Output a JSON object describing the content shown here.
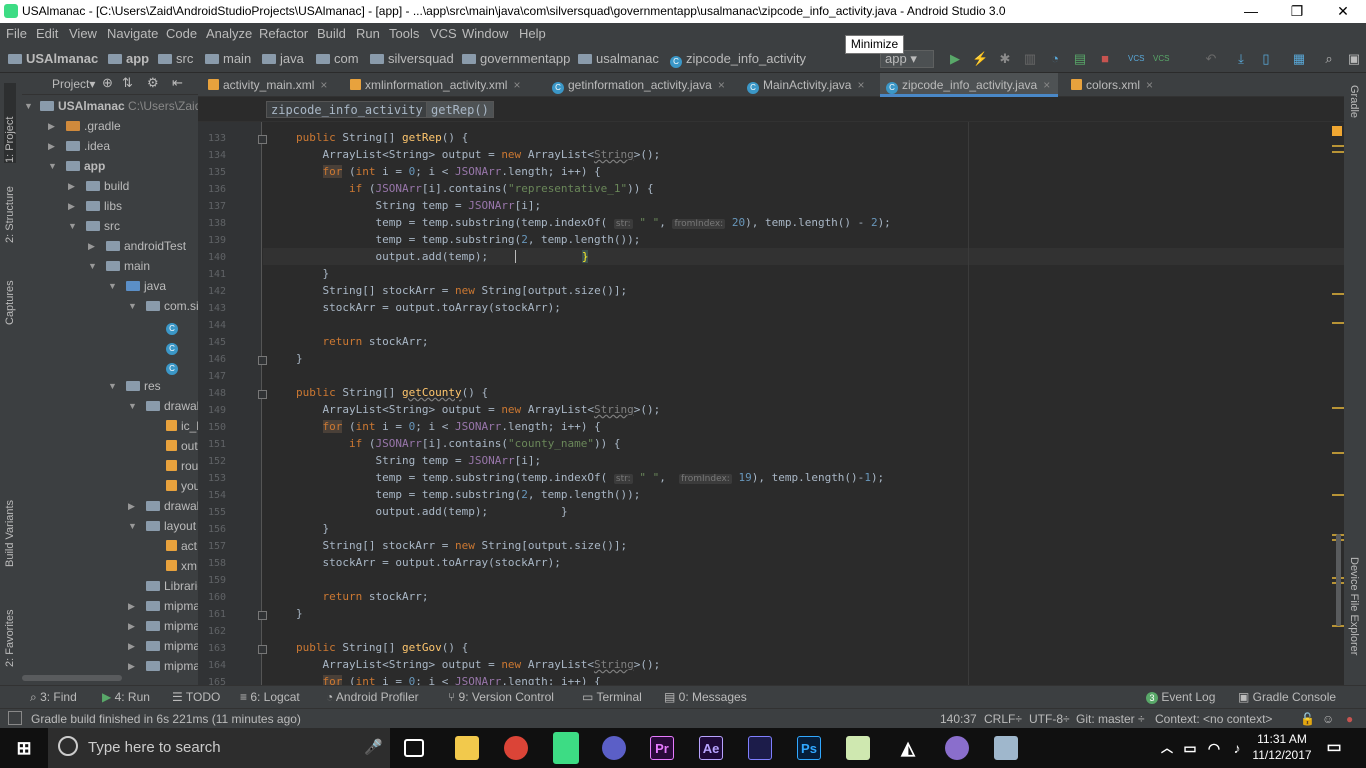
{
  "window": {
    "title": "USAlmanac - [C:\\Users\\Zaid\\AndroidStudioProjects\\USAlmanac] - [app] - ...\\app\\src\\main\\java\\com\\silversquad\\governmentapp\\usalmanac\\zipcode_info_activity.java - Android Studio 3.0",
    "minimize": "—",
    "maximize": "❐",
    "close": "✕",
    "tooltip": "Minimize"
  },
  "menu": [
    "File",
    "Edit",
    "View",
    "Navigate",
    "Code",
    "Analyze",
    "Refactor",
    "Build",
    "Run",
    "Tools",
    "VCS",
    "Window",
    "Help"
  ],
  "breadcrumbs": [
    "USAlmanac",
    "app",
    "src",
    "main",
    "java",
    "com",
    "silversquad",
    "governmentapp",
    "usalmanac",
    "zipcode_info_activity"
  ],
  "run_config": "app",
  "project_panel": {
    "title": "Project",
    "tree": [
      {
        "label": "USAlmanac",
        "extra": "C:\\Users\\Zaid"
      },
      {
        "label": ".gradle"
      },
      {
        "label": ".idea"
      },
      {
        "label": "app"
      },
      {
        "label": "build"
      },
      {
        "label": "libs"
      },
      {
        "label": "src"
      },
      {
        "label": "androidTest"
      },
      {
        "label": "main"
      },
      {
        "label": "java"
      },
      {
        "label": "com.si"
      },
      {
        "label": "C"
      },
      {
        "label": "C"
      },
      {
        "label": "C"
      },
      {
        "label": "res"
      },
      {
        "label": "drawab"
      },
      {
        "label": "ic_l"
      },
      {
        "label": "out"
      },
      {
        "label": "rou"
      },
      {
        "label": "you"
      },
      {
        "label": "drawab"
      },
      {
        "label": "layout"
      },
      {
        "label": "act"
      },
      {
        "label": "xm"
      },
      {
        "label": "Librarie"
      },
      {
        "label": "mipma"
      },
      {
        "label": "mipma"
      },
      {
        "label": "mipma"
      },
      {
        "label": "mipma"
      }
    ]
  },
  "left_tools": [
    "1: Project",
    "2: Structure",
    "Captures",
    "Build Variants",
    "2: Favorites"
  ],
  "right_tools": [
    "Gradle",
    "Device File Explorer"
  ],
  "tabs": [
    {
      "label": "activity_main.xml",
      "close": "×"
    },
    {
      "label": "xmlinformation_activity.xml",
      "close": "×"
    },
    {
      "label": "getinformation_activity.java",
      "close": "×"
    },
    {
      "label": "MainActivity.java",
      "close": "×"
    },
    {
      "label": "zipcode_info_activity.java",
      "close": "×"
    },
    {
      "label": "colors.xml",
      "close": "×"
    }
  ],
  "editor_crumbs": [
    "zipcode_info_activity",
    "getRep()"
  ],
  "line_numbers": [
    "133",
    "134",
    "135",
    "136",
    "137",
    "138",
    "139",
    "140",
    "141",
    "142",
    "143",
    "144",
    "145",
    "146",
    "147",
    "148",
    "149",
    "150",
    "151",
    "152",
    "153",
    "154",
    "155",
    "156",
    "157",
    "158",
    "159",
    "160",
    "161",
    "162",
    "163",
    "164",
    "165"
  ],
  "code": {
    "public": "public",
    "string_arr": "String[]",
    "string": "String",
    "for": "for",
    "int": "int",
    "if": "if",
    "new": "new",
    "return": "return",
    "getRep": "getRep",
    "getCounty": "getCounty",
    "getGov": "getGov",
    "paren_brace": "() {",
    "arraylist_pre": "ArrayList<String> output = ",
    "arraylist_mid": "ArrayList<",
    "arraylist_post": ">();",
    "i_init": " i = ",
    "zero": "0",
    "i_cond": "; i < ",
    "jsonarr": "JSONArr",
    "length_inc": ".length; i++) {",
    "open_paren": " (",
    "i_idx": "[i]",
    "contains": ".contains(",
    "rep_str": "\"representative_1\"",
    "county_str": "\"county_name\"",
    "close_brace_paren": ")) {",
    "temp_decl": " temp = ",
    "semi": ";",
    "temp_sub1": "temp = temp.substring(temp.indexOf(",
    "str_hint": "str:",
    "space_str": "\" \"",
    "comma": ", ",
    "from_hint": "fromIndex:",
    "twenty": "20",
    "nineteen": "19",
    "temp_len_m2": "), temp.length() - ",
    "two": "2",
    "close_semi": ");",
    "temp_len_m1": "), temp.length()-",
    "one": "1",
    "temp_sub2": "temp = temp.substring(",
    "temp_len": ", temp.length());",
    "output_add": "output.add(temp);",
    "close_brace": "}",
    "stockarr_pre": " stockArr = ",
    "output_size": "[output.size()];",
    "stockarr_assign": "stockArr = output.toArray(stockArr);",
    "stockarr_ret": " stockArr;"
  },
  "bottom_tools": [
    "3: Find",
    "4: Run",
    "TODO",
    "6: Logcat",
    "Android Profiler",
    "9: Version Control",
    "Terminal",
    "0: Messages",
    "Event Log",
    "Gradle Console"
  ],
  "event_count": "3",
  "status": {
    "message": "Gradle build finished in 6s 221ms (11 minutes ago)",
    "position": "140:37",
    "line_sep": "CRLF",
    "encoding": "UTF-8",
    "git": "Git: master",
    "context": "Context: <no context>"
  },
  "taskbar": {
    "search_placeholder": "Type here to search",
    "apps": [
      "Pr",
      "Ae",
      "Ps"
    ],
    "time": "11:31 AM",
    "date": "11/12/2017"
  }
}
